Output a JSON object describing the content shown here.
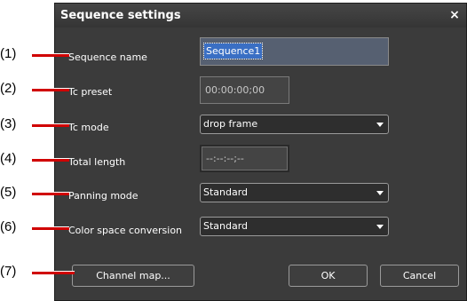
{
  "dialog": {
    "title": "Sequence settings",
    "close_glyph": "×"
  },
  "fields": {
    "sequence_name": {
      "label": "Sequence name",
      "value": "Sequence1"
    },
    "tc_preset": {
      "label": "Tc preset",
      "value": "00:00:00;00"
    },
    "tc_mode": {
      "label": "Tc mode",
      "value": "drop frame"
    },
    "total_length": {
      "label": "Total length",
      "value": "--:--:--;--"
    },
    "panning_mode": {
      "label": "Panning mode",
      "value": "Standard"
    },
    "color_space": {
      "label": "Color space conversion",
      "value": "Standard"
    }
  },
  "buttons": {
    "channel_map": "Channel map...",
    "ok": "OK",
    "cancel": "Cancel"
  },
  "callouts": [
    "(1)",
    "(2)",
    "(3)",
    "(4)",
    "(5)",
    "(6)",
    "(7)"
  ],
  "colors": {
    "dialog_bg": "#3b3b3b",
    "leader_line": "#d00000",
    "selection": "#3a6fc4"
  }
}
